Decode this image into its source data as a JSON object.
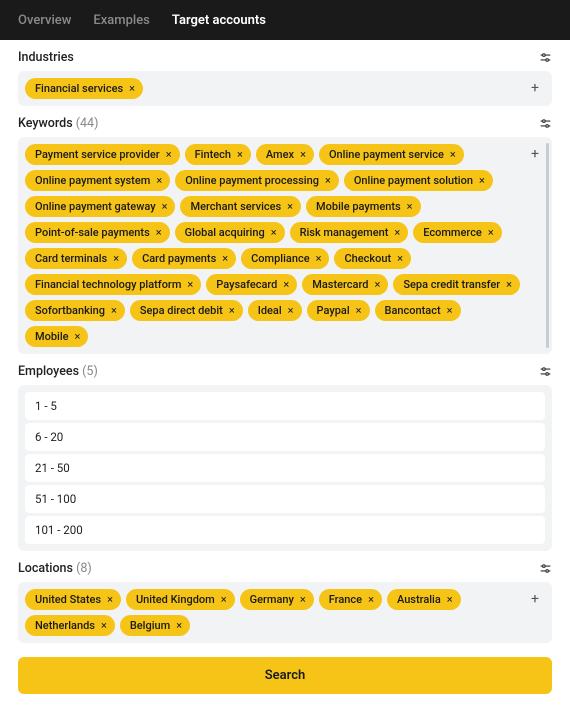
{
  "tabs": [
    "Overview",
    "Examples",
    "Target accounts"
  ],
  "activeTab": 2,
  "sections": {
    "industries": {
      "title": "Industries",
      "count": null,
      "chips": [
        "Financial services"
      ]
    },
    "keywords": {
      "title": "Keywords",
      "count": 44,
      "chips": [
        "Payment service provider",
        "Fintech",
        "Amex",
        "Online payment service",
        "Online payment system",
        "Online payment processing",
        "Online payment solution",
        "Online payment gateway",
        "Merchant services",
        "Mobile payments",
        "Point-of-sale payments",
        "Global acquiring",
        "Risk management",
        "Ecommerce",
        "Card terminals",
        "Card payments",
        "Compliance",
        "Checkout",
        "Financial technology platform",
        "Paysafecard",
        "Mastercard",
        "Sepa credit transfer",
        "Sofortbanking",
        "Sepa direct debit",
        "Ideal",
        "Paypal",
        "Bancontact",
        "Mobile"
      ]
    },
    "employees": {
      "title": "Employees",
      "count": 5,
      "rows": [
        "1 - 5",
        "6 - 20",
        "21 - 50",
        "51 - 100",
        "101 - 200"
      ]
    },
    "locations": {
      "title": "Locations",
      "count": 8,
      "chips": [
        "United States",
        "United Kingdom",
        "Germany",
        "France",
        "Australia",
        "Netherlands",
        "Belgium"
      ]
    }
  },
  "searchLabel": "Search",
  "icons": {
    "close": "×",
    "plus": "+"
  }
}
